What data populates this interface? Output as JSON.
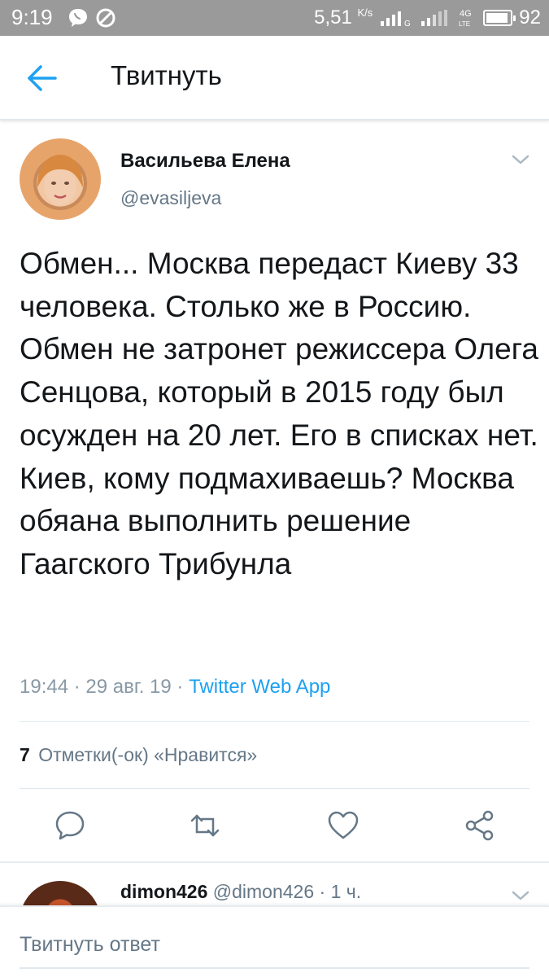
{
  "status_bar": {
    "time": "9:19",
    "speed": "5,51",
    "speed_unit": "K/s",
    "battery": "92",
    "battery_level_percent": 92
  },
  "header": {
    "title": "Твитнуть"
  },
  "tweet": {
    "author_name": "Васильева Елена",
    "author_handle": "@evasiljeva",
    "text": "Обмен... Москва передаст Киеву 33 человека. Столько же в Россию. Обмен не затронет режиссера Олега Сенцова, который в 2015 году был осужден на 20 лет. Его в списках нет. Киев, кому подмахиваешь? Москва обяана выполнить решение Гаагского Трибунла",
    "time": "19:44",
    "date": "29 авг. 19",
    "source": "Twitter Web App",
    "likes_count": "7",
    "likes_label": "Отметки(-ок) «Нравится»"
  },
  "reply_preview": {
    "name": "dimon426",
    "handle": "@dimon426",
    "age": "1 ч."
  },
  "compose": {
    "placeholder": "Твитнуть ответ"
  },
  "colors": {
    "accent": "#1da1f2",
    "status_bar": "#9a9a9a",
    "secondary_text": "#657786",
    "divider": "#e1e8ed"
  },
  "icons": {
    "back": "arrow-left-icon",
    "reply": "speech-bubble-icon",
    "retweet": "retweet-arrows-icon",
    "like": "heart-icon",
    "share": "share-nodes-icon",
    "menu": "chevron-down-icon"
  }
}
